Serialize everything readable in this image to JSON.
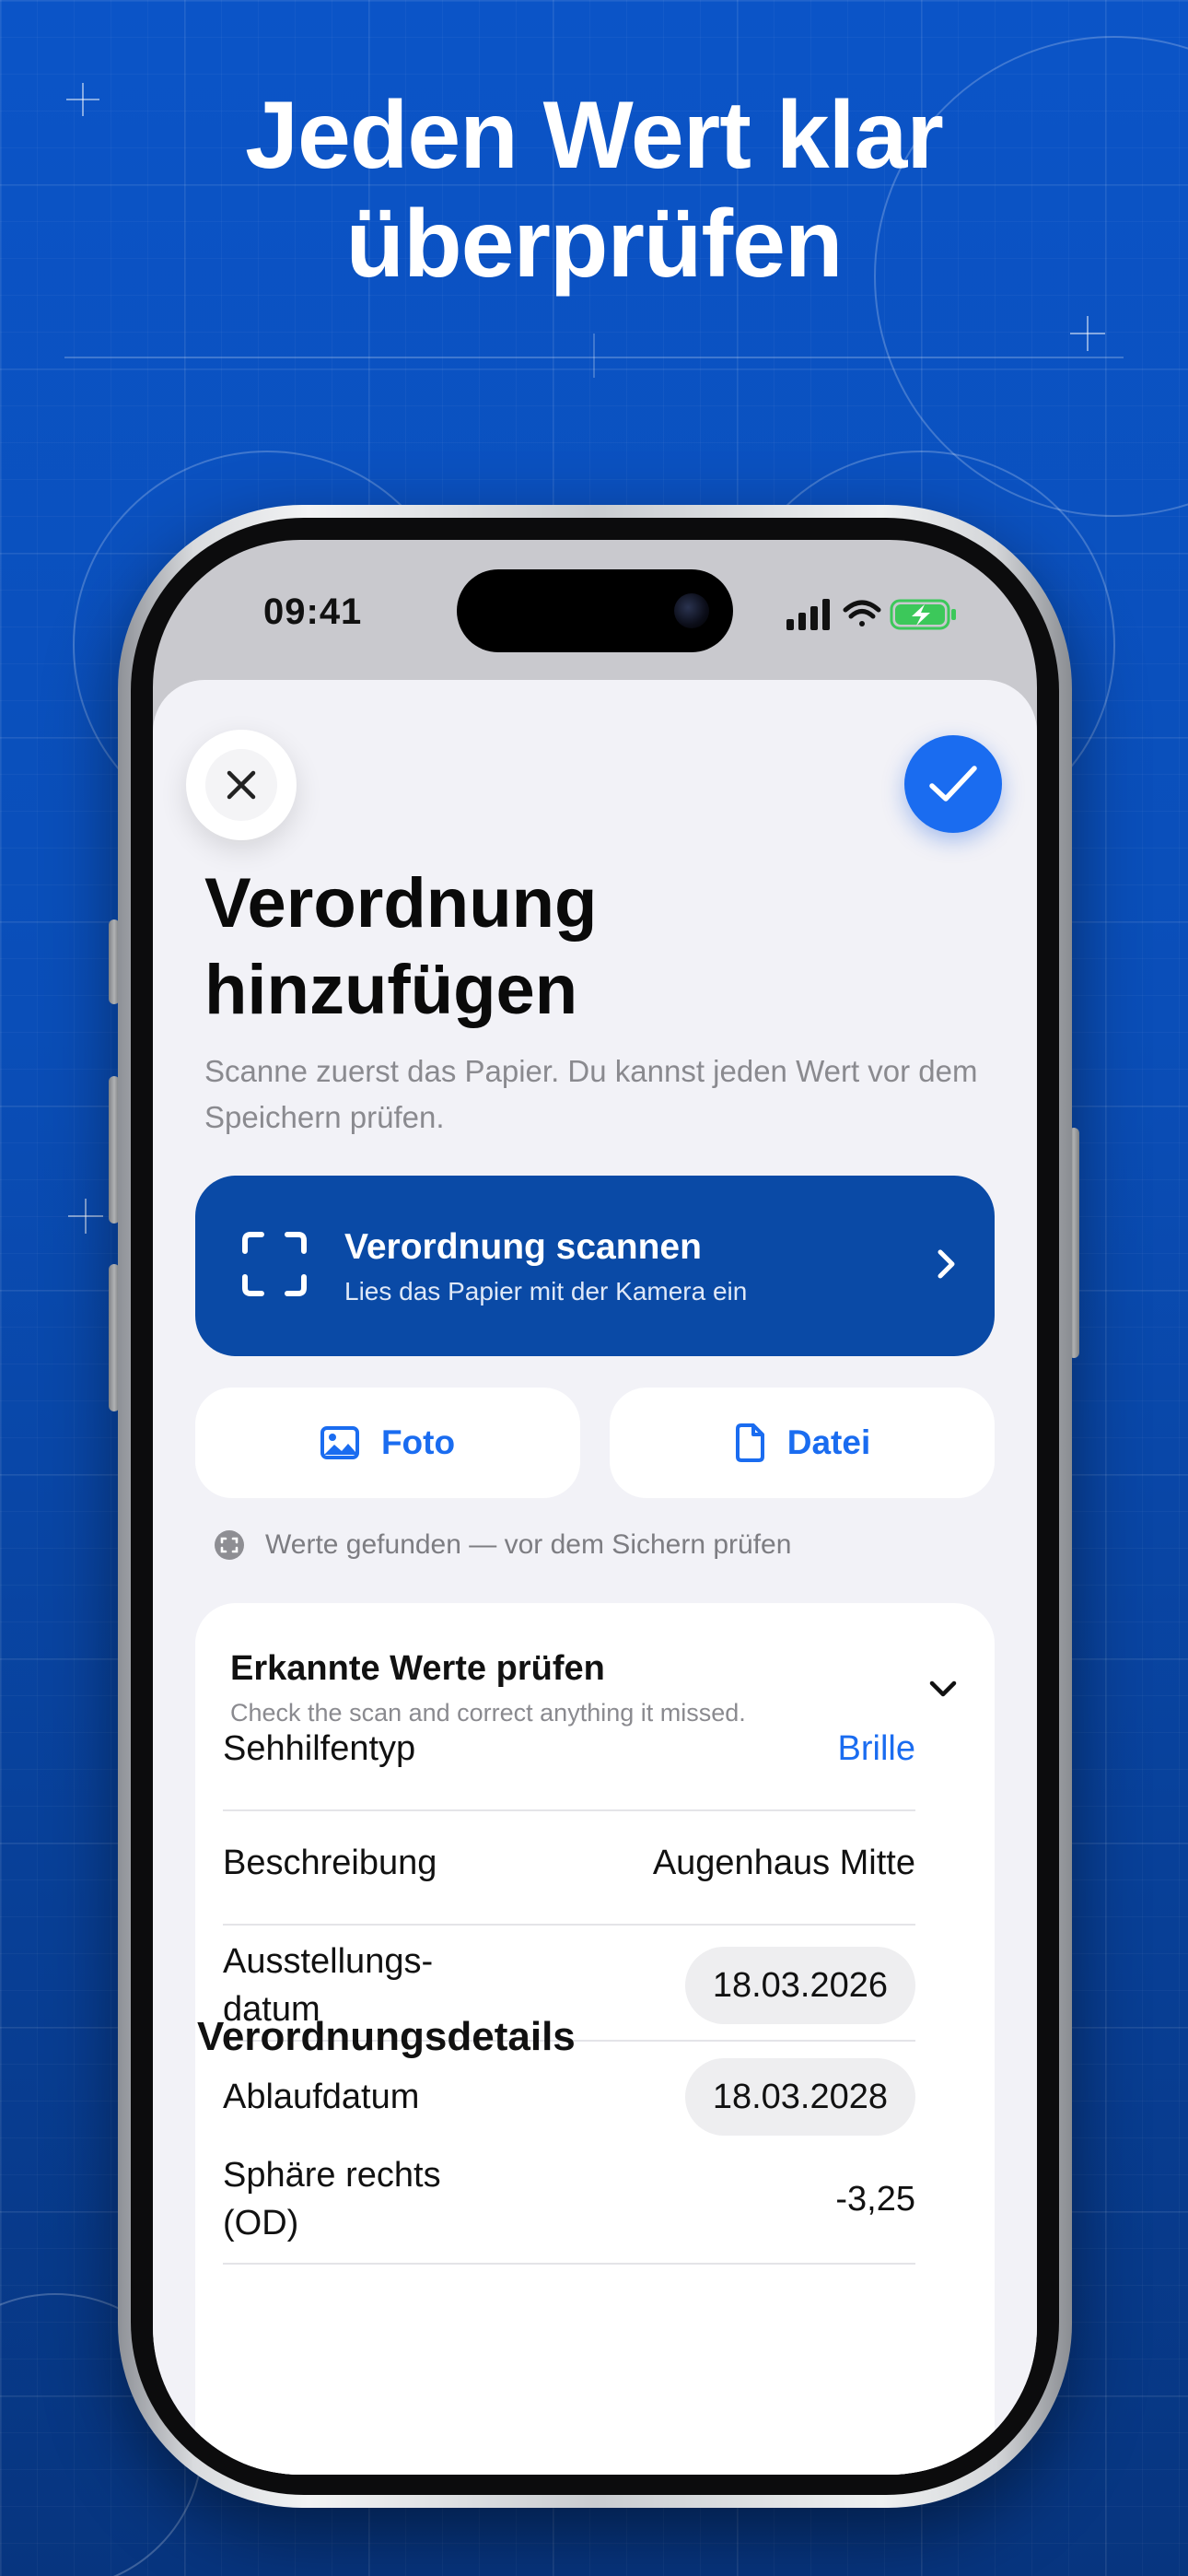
{
  "headline": {
    "line1": "Jeden Wert klar",
    "line2": "überprüfen"
  },
  "status_bar": {
    "time": "09:41"
  },
  "sheet": {
    "title_line1": "Verordnung",
    "title_line2": "hinzufügen",
    "subtitle": "Scanne zuerst das Papier. Du kannst jeden Wert vor dem Speichern prüfen."
  },
  "scan_card": {
    "title": "Verordnung scannen",
    "subtitle": "Lies das Papier mit der Kamera ein"
  },
  "import_buttons": {
    "photo": "Foto",
    "file": "Datei"
  },
  "found_status": "Werte gefunden — vor dem Sichern prüfen",
  "values_card": {
    "title": "Erkannte Werte prüfen",
    "subtitle": "Check the scan and correct anything it missed.",
    "rows": [
      {
        "label": "Sehhilfentyp",
        "value": "Brille"
      },
      {
        "label": "Beschreibung",
        "value": "Augenhaus Mitte"
      },
      {
        "label_line1": "Ausstellungs-",
        "label_line2": "datum",
        "value": "18.03.2026"
      },
      {
        "label": "Ablaufdatum",
        "value": "18.03.2028"
      }
    ],
    "section_title": "Verordnungsdetails",
    "detail_rows": [
      {
        "label_line1": "Sphäre rechts",
        "label_line2": "(OD)",
        "value": "-3,25"
      }
    ]
  },
  "colors": {
    "accent": "#1a6cf0",
    "scan_card": "#0a4aa6",
    "background": "#0b54c7"
  }
}
